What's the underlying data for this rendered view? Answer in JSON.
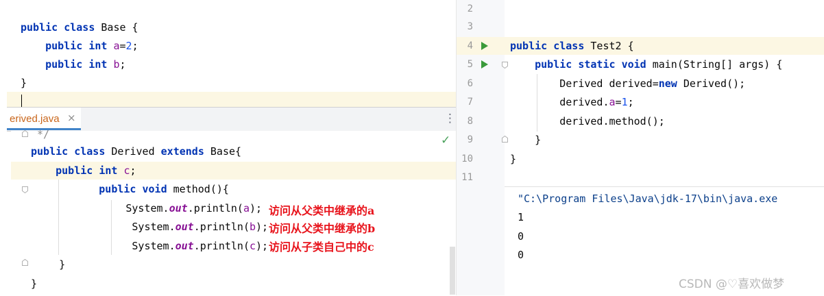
{
  "base_pane": {
    "lines": [
      {
        "seg": [
          [
            "kw",
            "public"
          ],
          [
            "t",
            " "
          ],
          [
            "kw",
            "class"
          ],
          [
            "t",
            " Base {"
          ]
        ]
      },
      {
        "seg": [
          [
            "t",
            "    "
          ],
          [
            "kw",
            "public"
          ],
          [
            "t",
            " "
          ],
          [
            "kw",
            "int"
          ],
          [
            "t",
            " "
          ],
          [
            "fld",
            "a"
          ],
          [
            "t",
            "="
          ],
          [
            "num",
            "2"
          ],
          [
            "t",
            ";"
          ]
        ]
      },
      {
        "seg": [
          [
            "t",
            "    "
          ],
          [
            "kw",
            "public"
          ],
          [
            "t",
            " "
          ],
          [
            "kw",
            "int"
          ],
          [
            "t",
            " "
          ],
          [
            "fld",
            "b"
          ],
          [
            "t",
            ";"
          ]
        ]
      },
      {
        "seg": [
          [
            "t",
            "}"
          ]
        ]
      }
    ]
  },
  "derived_pane": {
    "tab_label": "erived.java",
    "tab_close": "×",
    "menu_icon": "⋮",
    "check_icon": "✓",
    "lines": [
      {
        "seg": [
          [
            "t",
            " */"
          ]
        ]
      },
      {
        "seg": [
          [
            "kw",
            "public"
          ],
          [
            "t",
            " "
          ],
          [
            "kw",
            "class"
          ],
          [
            "t",
            " Derived "
          ],
          [
            "kw",
            "extends"
          ],
          [
            "t",
            " Base{"
          ]
        ]
      },
      {
        "seg": [
          [
            "t",
            "    "
          ],
          [
            "kw",
            "public"
          ],
          [
            "t",
            " "
          ],
          [
            "kw",
            "int"
          ],
          [
            "t",
            " "
          ],
          [
            "fld",
            "c"
          ],
          [
            "t",
            ";"
          ]
        ]
      },
      {
        "seg": [
          [
            "t",
            "         "
          ],
          [
            "kw",
            "public"
          ],
          [
            "t",
            " "
          ],
          [
            "kw",
            "void"
          ],
          [
            "t",
            " method(){"
          ]
        ]
      },
      {
        "seg": [
          [
            "t",
            "            System."
          ],
          [
            "st",
            "out"
          ],
          [
            "t",
            ".println("
          ],
          [
            "fld",
            "a"
          ],
          [
            "t",
            ");"
          ]
        ]
      },
      {
        "seg": [
          [
            "t",
            "             System."
          ],
          [
            "st",
            "out"
          ],
          [
            "t",
            ".println("
          ],
          [
            "fld",
            "b"
          ],
          [
            "t",
            ");"
          ]
        ]
      },
      {
        "seg": [
          [
            "t",
            "             System."
          ],
          [
            "st",
            "out"
          ],
          [
            "t",
            ".println("
          ],
          [
            "fld",
            "c"
          ],
          [
            "t",
            ");"
          ]
        ]
      },
      {
        "seg": [
          [
            "t",
            "    }"
          ]
        ]
      },
      {
        "seg": [
          [
            "t",
            "}"
          ]
        ]
      }
    ],
    "annotations": [
      "访问从父类中继承的a",
      "访问从父类中继承的b",
      "访问从子类自己中的c"
    ]
  },
  "test_pane": {
    "line_numbers": [
      "2",
      "3",
      "4",
      "5",
      "6",
      "7",
      "8",
      "9",
      "10",
      "11"
    ],
    "lines": [
      {
        "seg": [
          [
            "kw",
            "public"
          ],
          [
            "t",
            " "
          ],
          [
            "kw",
            "class"
          ],
          [
            "t",
            " Test2 {"
          ]
        ]
      },
      {
        "seg": [
          [
            "t",
            "    "
          ],
          [
            "kw",
            "public"
          ],
          [
            "t",
            " "
          ],
          [
            "kw",
            "static"
          ],
          [
            "t",
            " "
          ],
          [
            "kw",
            "void"
          ],
          [
            "t",
            " main(String[] args) {"
          ]
        ]
      },
      {
        "seg": [
          [
            "t",
            "        Derived derived="
          ],
          [
            "kw",
            "new"
          ],
          [
            "t",
            " Derived();"
          ]
        ]
      },
      {
        "seg": [
          [
            "t",
            "        derived."
          ],
          [
            "fld",
            "a"
          ],
          [
            "t",
            "="
          ],
          [
            "num",
            "1"
          ],
          [
            "t",
            ";"
          ]
        ]
      },
      {
        "seg": [
          [
            "t",
            "        derived.method();"
          ]
        ]
      },
      {
        "seg": [
          [
            "t",
            "    }"
          ]
        ]
      },
      {
        "seg": [
          [
            "t",
            "}"
          ]
        ]
      }
    ]
  },
  "console": {
    "command": "\"C:\\Program Files\\Java\\jdk-17\\bin\\java.exe",
    "outputs": [
      "1",
      "0",
      "0"
    ]
  },
  "watermark": "CSDN @♡喜欢做梦"
}
